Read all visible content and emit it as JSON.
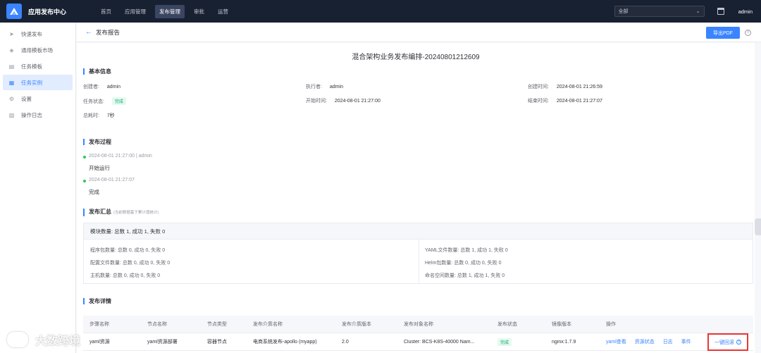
{
  "app": {
    "title": "应用发布中心"
  },
  "nav": {
    "items": [
      {
        "label": "首页",
        "active": false
      },
      {
        "label": "应用管理",
        "active": false
      },
      {
        "label": "发布管理",
        "active": true
      },
      {
        "label": "审批",
        "active": false
      },
      {
        "label": "运营",
        "active": false
      }
    ]
  },
  "topbar": {
    "select_value": "全部",
    "user": "admin"
  },
  "sidebar": {
    "items": [
      {
        "label": "快速发布",
        "icon": "send-icon"
      },
      {
        "label": "通用模板市场",
        "icon": "layers-icon"
      },
      {
        "label": "任务模板",
        "icon": "clipboard-icon"
      },
      {
        "label": "任务实例",
        "icon": "file-icon",
        "active": true
      },
      {
        "label": "设置",
        "icon": "gear-icon"
      },
      {
        "label": "操作日志",
        "icon": "log-icon"
      }
    ]
  },
  "header": {
    "title": "发布报告",
    "export_label": "导出PDF"
  },
  "report": {
    "title": "混合架构业务发布编排-20240801212609",
    "basic": {
      "section_title": "基本信息",
      "creator_label": "创建者:",
      "creator": "admin",
      "executor_label": "执行者:",
      "executor": "admin",
      "created_label": "创建时间:",
      "created": "2024-08-01 21:26:59",
      "status_label": "任务状态:",
      "status": "完成",
      "start_label": "开始时间:",
      "start": "2024-08-01 21:27:00",
      "end_label": "结束时间:",
      "end": "2024-08-01 21:27:07",
      "duration_label": "总耗时:",
      "duration": "7秒"
    },
    "process": {
      "section_title": "发布过程",
      "events": [
        {
          "meta": "2024-08-01 21:27:00 | admin",
          "text": "开始运行"
        },
        {
          "meta": "2024-08-01 21:27:07",
          "text": "完成"
        }
      ]
    },
    "summary": {
      "section_title": "发布汇总",
      "section_note": "(当前数据基于累计值统计)",
      "head": "模块数量: 总数 1, 成功 1, 失败 0",
      "left": [
        "程序包数量: 总数 0, 成功 0, 失败 0",
        "配置文件数量: 总数 0, 成功 0, 失败 0",
        "主机数量: 总数 0, 成功 0, 失败 0"
      ],
      "right": [
        "YAML文件数量: 总数 1, 成功 1, 失败 0",
        "Helm包数量: 总数 0, 成功 0, 失败 0",
        "命名空间数量: 总数 1, 成功 1, 失败 0"
      ]
    },
    "details": {
      "section_title": "发布详情",
      "columns": [
        "步骤名称",
        "节点名称",
        "节点类型",
        "发布介质名称",
        "发布介质版本",
        "发布对象名称",
        "发布状态",
        "镜像版本",
        "操作"
      ],
      "rows": [
        {
          "step": "yaml资源",
          "node": "yaml资源部署",
          "node_type": "容器节点",
          "media": "电商系统发布-apollo (myapp)",
          "media_version": "2.0",
          "target": "Cluster: BCS-K8S-40000 Nam...",
          "status": "完成",
          "image": "nginx:1.7.9",
          "actions": [
            "yaml查看",
            "资源状态",
            "日志",
            "事件"
          ],
          "rollback": "一键回滚"
        }
      ]
    }
  },
  "watermark": "大数跨境"
}
